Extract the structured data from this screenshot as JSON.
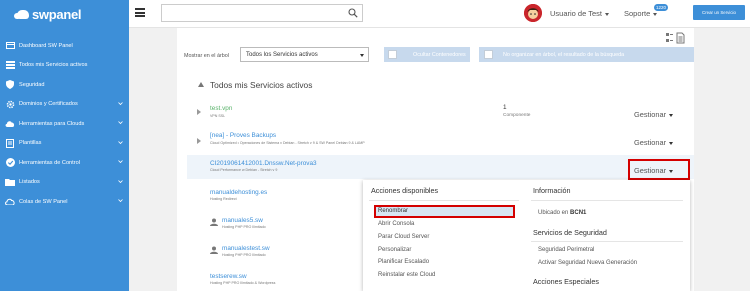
{
  "brand": {
    "name": "swpanel"
  },
  "sidebar": {
    "items": [
      {
        "label": "Dashboard SW Panel",
        "icon": "dashboard-icon",
        "has_chevron": false
      },
      {
        "label": "Todos mis Servicios activos",
        "icon": "list-icon",
        "has_chevron": false
      },
      {
        "label": "Seguridad",
        "icon": "shield-icon",
        "has_chevron": false
      },
      {
        "label": "Dominios y Certificados",
        "icon": "gear-icon",
        "has_chevron": true
      },
      {
        "label": "Herramientas para Clouds",
        "icon": "cloud-icon",
        "has_chevron": true
      },
      {
        "label": "Plantillas",
        "icon": "template-icon",
        "has_chevron": true
      },
      {
        "label": "Herramientas de Control",
        "icon": "check-circle-icon",
        "has_chevron": true
      },
      {
        "label": "Listados",
        "icon": "folder-icon",
        "has_chevron": true
      },
      {
        "label": "Colas de SW Panel",
        "icon": "cloud-queue-icon",
        "has_chevron": true
      }
    ]
  },
  "header": {
    "search": {
      "placeholder": "",
      "value": ""
    },
    "user_label": "Usuario de Test",
    "support_label": "Soporte",
    "support_badge": "1220",
    "create_button": "Crear un Servicio"
  },
  "filters": {
    "show_label": "Mostrar en el árbol",
    "select_value": "Todos los Servicios activos",
    "hide_containers": "Ocultar Contenedores",
    "no_tree_label": "No organizar en árbol, el resultado de la búsqueda"
  },
  "section": {
    "title": "Todos mis Servicios activos"
  },
  "services": [
    {
      "title": "test.vpn",
      "subtitle": "VPN SSL",
      "count": "1",
      "count_label": "Componente",
      "manage": "Gestionar"
    },
    {
      "title": "[nea] - Proves Backups",
      "subtitle": "Cloud Optimized • Operaciones de Sistema v Debian - Stretch v 9 & SW Panel Debian 9 & LAMP",
      "manage": "Gestionar"
    },
    {
      "title": "CI2019061412001.Dnssw.Net-prova3",
      "subtitle": "Cloud Performance w Debian - Stretch v 9",
      "manage": "Gestionar"
    },
    {
      "title": "manualdehosting.es",
      "subtitle": "Hosting Redirect"
    },
    {
      "title": "manuales5.sw",
      "subtitle": "Hosting PHP PRO Ilimitado"
    },
    {
      "title": "manualestest.sw",
      "subtitle": "Hosting PHP PRO Ilimitado"
    },
    {
      "title": "testserew.sw",
      "subtitle": "Hosting PHP PRO Ilimitado & Wordpress"
    }
  ],
  "dropdown": {
    "actions_title": "Acciones disponibles",
    "actions": [
      "Renombrar",
      "Abrir Consola",
      "Parar Cloud Server",
      "Personalizar",
      "Planificar Escalado",
      "Reinstalar este Cloud"
    ],
    "info_title": "Información",
    "location_prefix": "Ubicado en",
    "location_value": "BCN1",
    "security_title": "Servicios de Seguridad",
    "security_items": [
      "Seguridad Perimetral",
      "Activar Seguridad Nueva Generación"
    ],
    "special_title": "Acciones Especiales"
  },
  "colors": {
    "brand_blue": "#3d8fd8",
    "highlight_red": "#d40000",
    "link_blue": "#3d8fd8"
  }
}
